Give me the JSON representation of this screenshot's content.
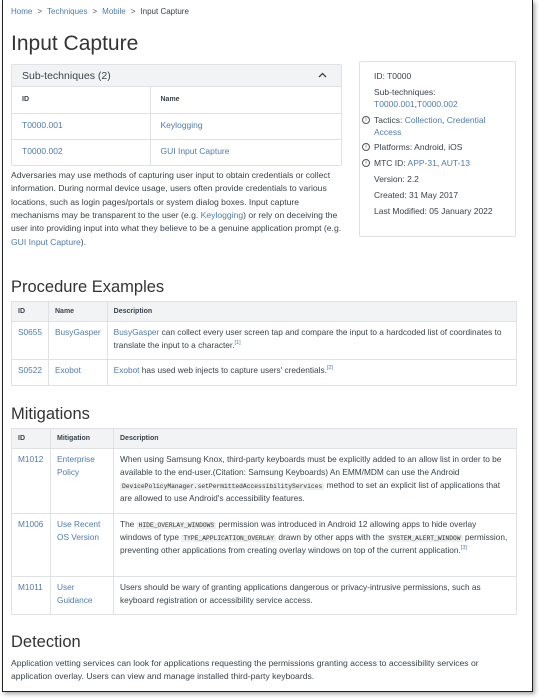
{
  "breadcrumb": {
    "home": "Home",
    "techniques": "Techniques",
    "mobile": "Mobile",
    "current": "Input Capture",
    "sep": ">"
  },
  "title": "Input Capture",
  "subtechniques": {
    "header": "Sub-techniques (2)",
    "col_id": "ID",
    "col_name": "Name",
    "rows": [
      {
        "id": "T0000.001",
        "name": "Keylogging"
      },
      {
        "id": "T0000.002",
        "name": "GUI Input Capture"
      }
    ]
  },
  "description": {
    "part1": "Adversaries may use methods of capturing user input to obtain credentials or collect information. During normal device usage, users often provide credentials to various locations, such as login pages/portals or system dialog boxes. Input capture mechanisms may be transparent to the user (e.g. ",
    "link1": "Keylogging",
    "part2": ") or rely on deceiving the user into providing input into what they believe to be a genuine application prompt (e.g. ",
    "link2": "GUI Input Capture",
    "part3": ")."
  },
  "card": {
    "id_label": "ID:",
    "id_value": "T0000",
    "subtech_label": "Sub-techniques:",
    "subtech_1": "T0000.001",
    "subtech_sep": ",",
    "subtech_2": "T0000.002",
    "tactics_label": "Tactics:",
    "tactic_1": "Collection",
    "tactic_sep": ", ",
    "tactic_2": "Credential Access",
    "platforms_label": "Platforms:",
    "platforms_value": "Android, iOS",
    "mtc_label": "MTC ID:",
    "mtc_1": "APP-31",
    "mtc_sep": ", ",
    "mtc_2": "AUT-13",
    "version_label": "Version:",
    "version_value": "2.2",
    "created_label": "Created:",
    "created_value": "31 May 2017",
    "modified_label": "Last Modified:",
    "modified_value": "05 January 2022",
    "info_glyph": "i"
  },
  "procedures": {
    "heading": "Procedure Examples",
    "col_id": "ID",
    "col_name": "Name",
    "col_desc": "Description",
    "rows": [
      {
        "id": "S0655",
        "name": "BusyGasper",
        "desc_link": "BusyGasper",
        "desc_text": " can collect every user screen tap and compare the input to a hardcoded list of coordinates to translate the input to a character.",
        "cite": "[1]"
      },
      {
        "id": "S0522",
        "name": "Exobot",
        "desc_link": "Exobot",
        "desc_text": " has used web injects to capture users' credentials.",
        "cite": "[2]"
      }
    ]
  },
  "mitigations": {
    "heading": "Mitigations",
    "col_id": "ID",
    "col_name": "Mitigation",
    "col_desc": "Description",
    "rows": [
      {
        "id": "M1012",
        "name": "Enterprise Policy",
        "t1": "When using Samsung Knox, third-party keyboards must be explicitly added to an allow list in order to be available to the end-user.(Citation: Samsung Keyboards) An EMM/MDM can use the Android ",
        "c1": "DevicePolicyManager.setPermittedAccessibilityServices",
        "t2": " method to set an explicit list of applications that are allowed to use Android's accessibility features."
      },
      {
        "id": "M1006",
        "name": "Use Recent OS Version",
        "t1": "The ",
        "c1": "HIDE_OVERLAY_WINDOWS",
        "t2": " permission was introduced in Android 12 allowing apps to hide overlay windows of type ",
        "c2": "TYPE_APPLICATION_OVERLAY",
        "t3": " drawn by other apps with the ",
        "c3": "SYSTEM_ALERT_WINDOW",
        "t4": " permission, preventing other applications from creating overlay windows on top of the current application.",
        "cite": "[3]"
      },
      {
        "id": "M1011",
        "name": "User Guidance",
        "t1": "Users should be wary of granting applications dangerous or privacy-intrusive permissions, such as keyboard registration or accessibility service access."
      }
    ]
  },
  "detection": {
    "heading": "Detection",
    "text": "Application vetting services can look for applications requesting the permissions granting access to accessibility services or application overlay. Users can view and manage installed third-party keyboards."
  },
  "colors": {
    "link": "#4f7cac",
    "text": "#39434c",
    "header_bg": "#f2f3f4",
    "border": "#dfe1e4"
  }
}
